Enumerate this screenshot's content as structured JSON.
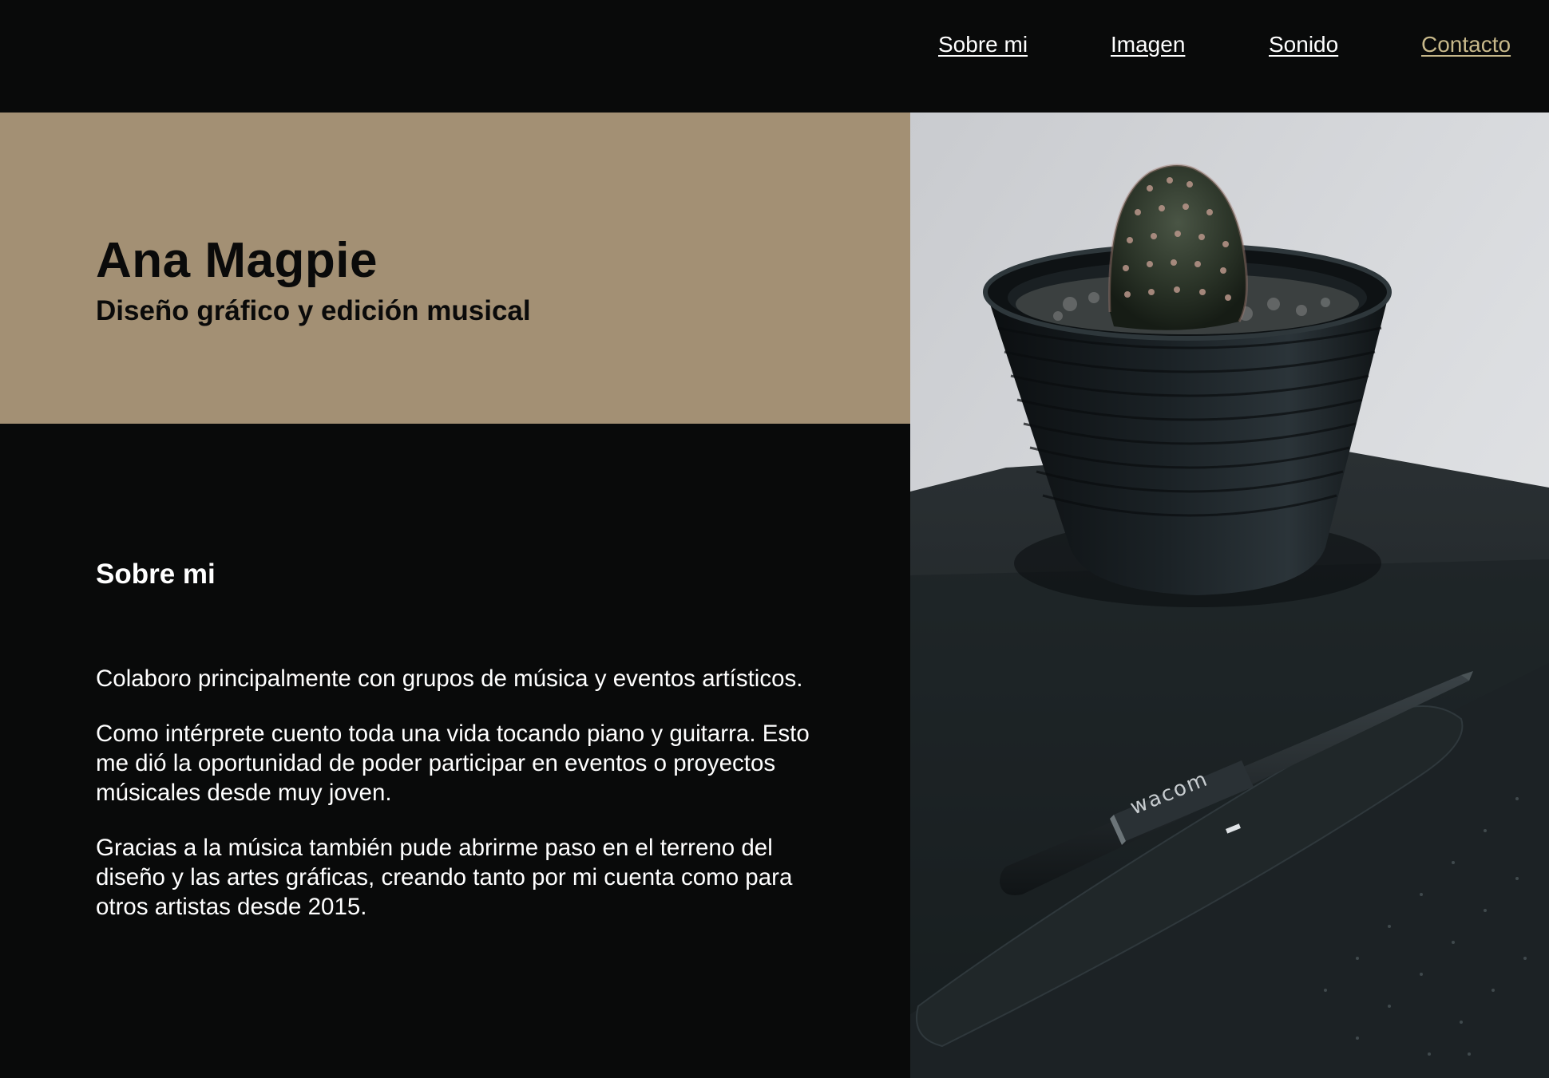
{
  "nav": {
    "items": [
      {
        "label": "Sobre mi"
      },
      {
        "label": "Imagen"
      },
      {
        "label": "Sonido"
      },
      {
        "label": "Contacto"
      }
    ],
    "active_color": "#c7b88a",
    "link_color": "#ffffff"
  },
  "hero": {
    "name": "Ana Magpie",
    "subtitle": "Diseño gráfico y edición musical",
    "background_color": "#a39074"
  },
  "about": {
    "title": "Sobre mi",
    "paragraphs": [
      "Colaboro principalmente con grupos de música y eventos artísticos.",
      "Como intérprete cuento toda una vida tocando piano y guitarra. Esto me dió la oportunidad de poder participar en eventos o proyectos músicales desde muy joven.",
      "Gracias a la música también pude abrirme paso en el terreno del diseño y las artes gráficas, creando tanto por mi cuenta como para otros artistas desde 2015."
    ]
  },
  "photo": {
    "brand_text": "wacom"
  },
  "colors": {
    "page_background": "#090a0a",
    "text_light": "#ffffff",
    "text_dark": "#0a0a0a"
  }
}
